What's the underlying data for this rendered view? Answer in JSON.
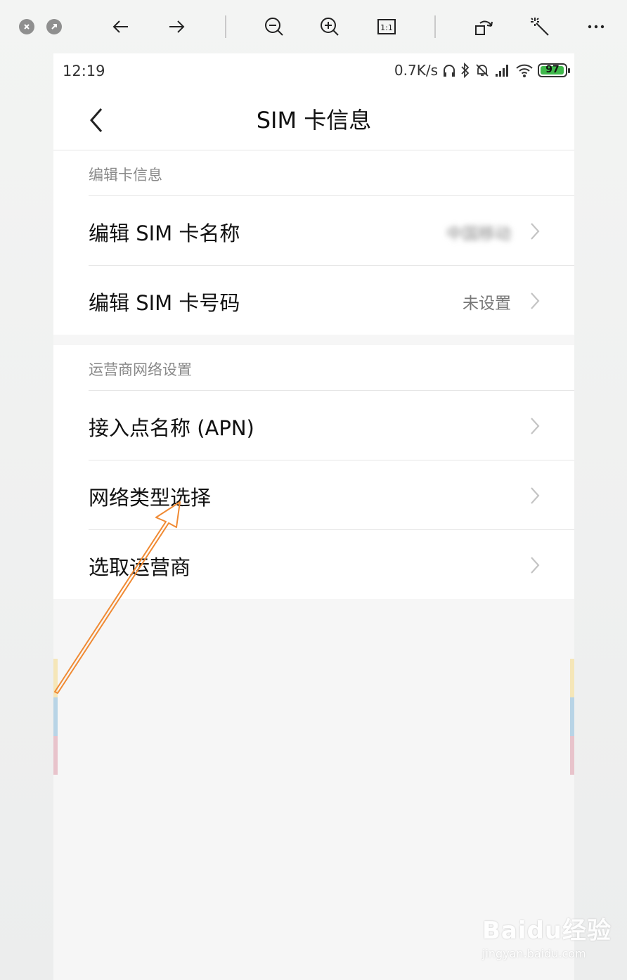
{
  "viewer_toolbar": {
    "icons": [
      "close-icon",
      "restore-icon",
      "back-arrow-icon",
      "forward-arrow-icon",
      "zoom-out-icon",
      "zoom-in-icon",
      "actual-size-icon",
      "rotate-icon",
      "magic-wand-icon",
      "more-icon"
    ],
    "actual_size_label": "1:1"
  },
  "status_bar": {
    "time": "12:19",
    "speed": "0.7K/s",
    "battery": "97",
    "battery_level": 0.97
  },
  "header": {
    "title": "SIM 卡信息"
  },
  "section_card_info": {
    "title": "编辑卡信息",
    "items": [
      {
        "label": "编辑 SIM 卡名称",
        "value": "中国移动"
      },
      {
        "label": "编辑 SIM 卡号码",
        "value": "未设置"
      }
    ]
  },
  "section_network": {
    "title": "运营商网络设置",
    "items": [
      {
        "label": "接入点名称 (APN)"
      },
      {
        "label": "网络类型选择"
      },
      {
        "label": "选取运营商"
      }
    ]
  },
  "watermark": {
    "main": "Baidu经验",
    "sub": "jingyan.baidu.com"
  },
  "colors": {
    "annotation_arrow": "#f08a33",
    "battery_green": "#3fb84b",
    "stripe_yellow": "#f5e6b8",
    "stripe_blue": "#b8d4e6",
    "stripe_pink": "#e8c3cb"
  }
}
